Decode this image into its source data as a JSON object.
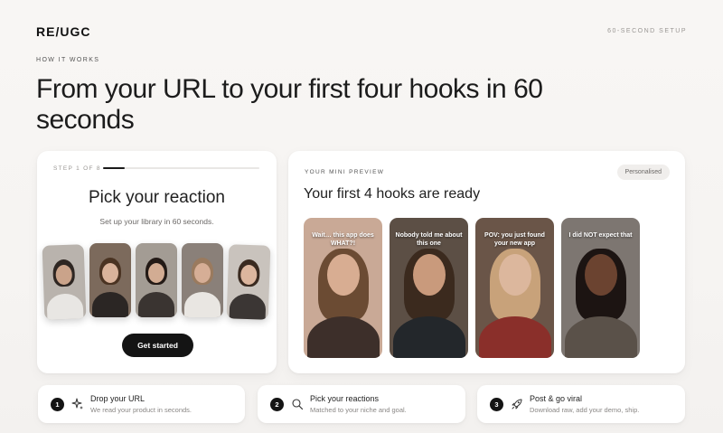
{
  "brand": {
    "logo": "RE/UGC",
    "setup_tag": "60-SECOND SETUP"
  },
  "hero": {
    "eyebrow": "HOW IT WORKS",
    "headline": "From your URL to your first four hooks in 60 seconds"
  },
  "onboarding": {
    "step_label": "STEP 1 OF 8",
    "progress": 0.14,
    "title": "Pick your reaction",
    "subtitle": "Set up your library in 60 seconds.",
    "reactions": [
      {
        "bg": "#b9b3ad",
        "skin": "#caa38a",
        "hair": "#2e2622",
        "shirt": "#e8e6e3"
      },
      {
        "bg": "#7c6a5c",
        "skin": "#d9b39b",
        "hair": "#4a3322",
        "shirt": "#2b2624"
      },
      {
        "bg": "#a39c94",
        "skin": "#d2ac93",
        "hair": "#231a16",
        "shirt": "#3a3431"
      },
      {
        "bg": "#8a8079",
        "skin": "#d6ae96",
        "hair": "#9a7a5e",
        "shirt": "#e9e6e2"
      },
      {
        "bg": "#c9c3bd",
        "skin": "#dcb69e",
        "hair": "#3a2a20",
        "shirt": "#3b3634"
      }
    ],
    "cta": "Get started"
  },
  "preview": {
    "label": "YOUR MINI PREVIEW",
    "badge": "Personalised",
    "title": "Your first 4 hooks are ready",
    "hooks": [
      {
        "caption": "Wait… this app does WHAT?!",
        "bg": "#c9a996",
        "skin": "#d8ad92",
        "hair": "#6b4b33",
        "shirt": "#3d2f2a"
      },
      {
        "caption": "Nobody told me about this one",
        "bg": "#5c4f45",
        "skin": "#c99a7c",
        "hair": "#3b2a1e",
        "shirt": "#23272b"
      },
      {
        "caption": "POV: you just found your new app",
        "bg": "#6a5548",
        "skin": "#dcb79d",
        "hair": "#c8a27a",
        "shirt": "#8a2f2a"
      },
      {
        "caption": "I did NOT expect that",
        "bg": "#7d7671",
        "skin": "#6b4330",
        "hair": "#1c1412",
        "shirt": "#5a5149"
      }
    ]
  },
  "steps": [
    {
      "number": "1",
      "icon": "sparkle-icon",
      "title": "Drop your URL",
      "description": "We read your product in seconds."
    },
    {
      "number": "2",
      "icon": "search-icon",
      "title": "Pick your reactions",
      "description": "Matched to your niche and goal."
    },
    {
      "number": "3",
      "icon": "rocket-icon",
      "title": "Post & go viral",
      "description": "Download raw, add your demo, ship."
    }
  ]
}
